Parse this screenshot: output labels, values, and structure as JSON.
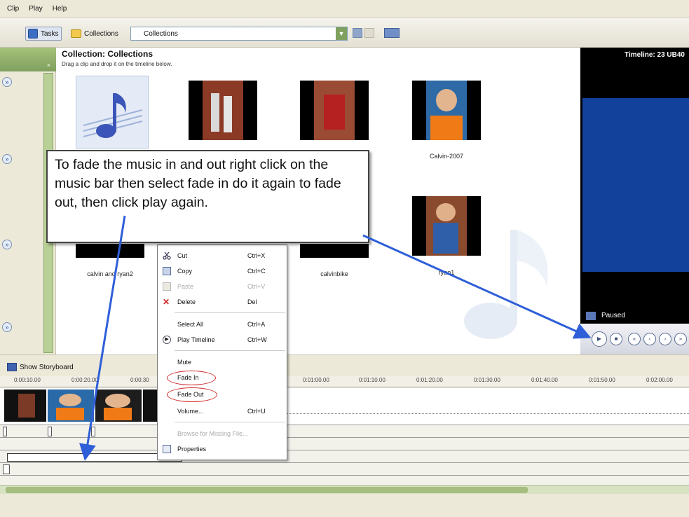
{
  "menu": [
    "Clip",
    "Play",
    "Help"
  ],
  "toolbar": {
    "tasks_label": "Tasks",
    "collections_label": "Collections",
    "collection_select": "Collections"
  },
  "collection": {
    "title": "Collection: Collections",
    "subtitle": "Drag a clip and drop it on the timeline below.",
    "clips": [
      {
        "label": ""
      },
      {
        "label": ""
      },
      {
        "label": ""
      },
      {
        "label": "Calvin-2007"
      },
      {
        "label": "calvin and ryan2"
      },
      {
        "label": "calvinbike"
      },
      {
        "label": "ryan1"
      }
    ]
  },
  "preview": {
    "title": "Timeline: 23 UB40",
    "status": "Paused"
  },
  "timeline": {
    "storyboard_label": "Show Storyboard",
    "ruler": [
      "0:00:10.00",
      "0:00:20.00",
      "0:00:30",
      "0:01:00.00",
      "0:01:10.00",
      "0:01:20.00",
      "0:01:30.00",
      "0:01:40.00",
      "0:01:50.00",
      "0:02:00.00"
    ]
  },
  "context_menu": {
    "cut": "Cut",
    "cut_key": "Ctrl+X",
    "copy": "Copy",
    "copy_key": "Ctrl+C",
    "paste": "Paste",
    "paste_key": "Ctrl+V",
    "delete": "Delete",
    "delete_key": "Del",
    "select_all": "Select All",
    "select_all_key": "Ctrl+A",
    "play_timeline": "Play Timeline",
    "play_timeline_key": "Ctrl+W",
    "mute": "Mute",
    "fade_in": "Fade In",
    "fade_out": "Fade Out",
    "volume": "Volume...",
    "volume_key": "Ctrl+U",
    "browse": "Browse for Missing File...",
    "properties": "Properties"
  },
  "callout": {
    "text": "To fade the music in and out right  click on the music bar then select fade in do it again to fade out, then click play again."
  },
  "colors": {
    "annotation_arrow": "#2f5fd8",
    "highlight_ellipse": "#d02828",
    "preview_screen": "#12419c"
  }
}
